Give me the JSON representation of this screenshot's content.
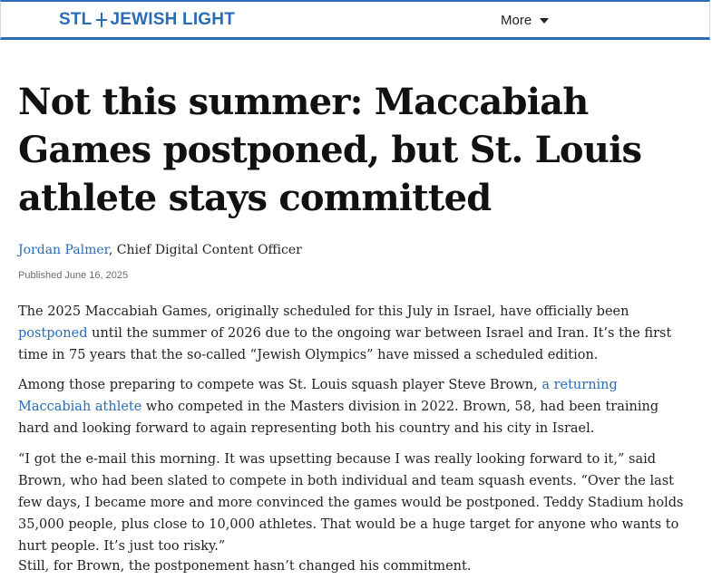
{
  "header": {
    "logo_left": "STL",
    "logo_right": "JEWISH LIGHT",
    "more_label": "More"
  },
  "article": {
    "headline": "Not this summer: Maccabiah Games postponed, but St. Louis athlete stays committed",
    "author": "Jordan Palmer",
    "author_role": ", Chief Digital Content Officer",
    "published": "Published June 16, 2025",
    "p1": {
      "before": "The 2025 Maccabiah Games, originally scheduled for this July in Israel, have officially been ",
      "link": "postponed",
      "after": " until the summer of 2026 due to the ongoing war between Israel and Iran. It’s the first time in 75 years that the so-called “Jewish Olympics” have missed a scheduled edition."
    },
    "p2": {
      "before": "Among those preparing to compete was St. Louis squash player Steve Brown, ",
      "link": "a returning Maccabiah athlete",
      "after": " who competed in the Masters division in 2022. Brown, 58, had been training hard and looking forward to again representing both his country and his city in Israel."
    },
    "p3": "“I got the e-mail this morning. It was upsetting because I was really looking forward to it,” said Brown, who had been slated to compete in both individual and team squash events. “Over the last few days, I became more and more convinced the games would be postponed. Teddy Stadium holds 35,000 people, plus close to 10,000 athletes. That would be a huge target for anyone who wants to hurt people. It’s just too risky.”",
    "p4": "Still, for Brown, the postponement hasn’t changed his commitment."
  },
  "colors": {
    "brand": "#2a6cb6",
    "text": "#222222"
  }
}
